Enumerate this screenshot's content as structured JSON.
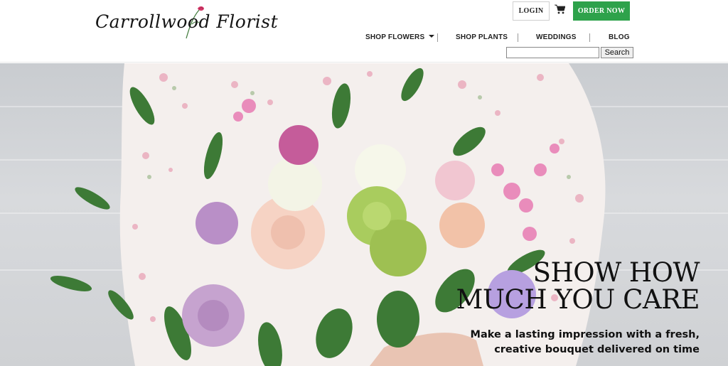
{
  "brand": {
    "logo_text": "Carrollwood Florist"
  },
  "header": {
    "login_label": "LOGIN",
    "cart_icon": "cart-icon",
    "order_label": "ORDER NOW",
    "order_color": "#2ea24b"
  },
  "nav": {
    "items": [
      {
        "label": "SHOP FLOWERS",
        "has_dropdown": true
      },
      {
        "label": "SHOP PLANTS"
      },
      {
        "label": "WEDDINGS"
      },
      {
        "label": "BLOG"
      }
    ]
  },
  "search": {
    "value": "",
    "placeholder": "",
    "button_label": "Search"
  },
  "hero": {
    "headline_line1": "SHOW HOW",
    "headline_line2": "MUCH YOU CARE",
    "subline_line1": "Make a lasting impression with a fresh,",
    "subline_line2": "creative bouquet delivered on time"
  }
}
